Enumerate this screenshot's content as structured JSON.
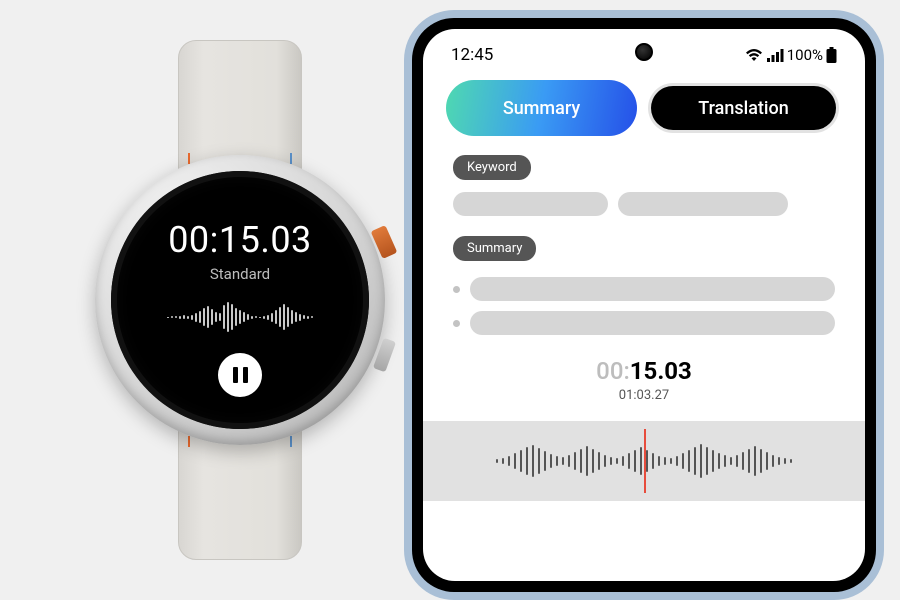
{
  "watch": {
    "timer": "00:15.03",
    "mode": "Standard",
    "wave_heights": [
      1,
      2,
      2,
      3,
      4,
      3,
      5,
      9,
      12,
      18,
      22,
      16,
      10,
      8,
      24,
      30,
      26,
      18,
      14,
      10,
      6,
      3,
      2,
      1,
      3,
      5,
      9,
      14,
      20,
      26,
      20,
      14,
      10,
      7,
      4,
      3,
      2
    ]
  },
  "phone": {
    "status": {
      "time": "12:45",
      "battery": "100%"
    },
    "tabs": {
      "summary": "Summary",
      "translation": "Translation"
    },
    "labels": {
      "keyword": "Keyword",
      "summary": "Summary"
    },
    "playtime": {
      "pre": "00:",
      "rest": "15.03",
      "total": "01:03.27"
    },
    "wave_heights": [
      4,
      6,
      10,
      16,
      22,
      28,
      32,
      26,
      20,
      14,
      10,
      8,
      12,
      18,
      24,
      30,
      24,
      18,
      12,
      8,
      6,
      10,
      16,
      22,
      28,
      22,
      16,
      10,
      8,
      6,
      10,
      16,
      22,
      28,
      34,
      28,
      22,
      16,
      12,
      8,
      12,
      18,
      24,
      30,
      24,
      18,
      12,
      8,
      6,
      4
    ]
  }
}
